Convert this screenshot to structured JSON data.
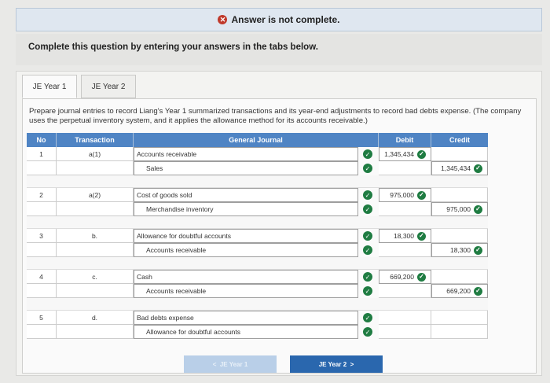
{
  "banner": {
    "text": "Answer is not complete."
  },
  "instruction": "Complete this question by entering your answers in the tabs below.",
  "tabs": [
    {
      "label": "JE Year 1"
    },
    {
      "label": "JE Year 2"
    }
  ],
  "prompt": "Prepare journal entries to record Liang's Year 1 summarized transactions and its year-end adjustments to record bad debts expense. (The company uses the perpetual inventory system, and it applies the allowance method for its accounts receivable.)",
  "journal": {
    "headers": {
      "no": "No",
      "transaction": "Transaction",
      "general_journal": "General Journal",
      "debit": "Debit",
      "credit": "Credit"
    },
    "entries": [
      {
        "no": "1",
        "transaction": "a(1)",
        "debit_account": "Accounts receivable",
        "credit_account": "Sales",
        "debit": "1,345,434",
        "credit": "1,345,434"
      },
      {
        "no": "2",
        "transaction": "a(2)",
        "debit_account": "Cost of goods sold",
        "credit_account": "Merchandise inventory",
        "debit": "975,000",
        "credit": "975,000"
      },
      {
        "no": "3",
        "transaction": "b.",
        "debit_account": "Allowance for doubtful accounts",
        "credit_account": "Accounts receivable",
        "debit": "18,300",
        "credit": "18,300"
      },
      {
        "no": "4",
        "transaction": "c.",
        "debit_account": "Cash",
        "credit_account": "Accounts receivable",
        "debit": "669,200",
        "credit": "669,200"
      },
      {
        "no": "5",
        "transaction": "d.",
        "debit_account": "Bad debts expense",
        "credit_account": "Allowance for doubtful accounts",
        "debit": "",
        "credit": ""
      }
    ]
  },
  "nav": {
    "prev": "JE Year 1",
    "next": "JE Year 2"
  }
}
